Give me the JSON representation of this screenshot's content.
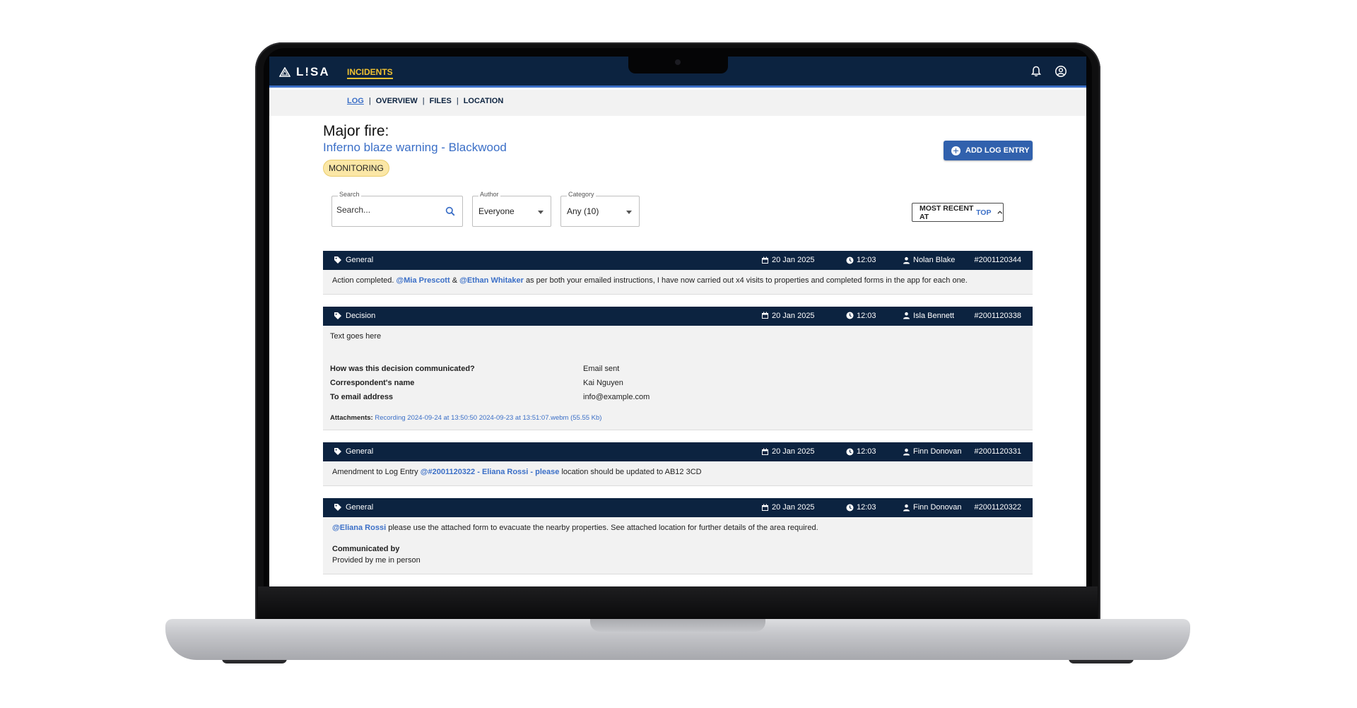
{
  "app": {
    "logo_text": "L!SA",
    "nav_incidents": "INCIDENTS"
  },
  "subnav": {
    "log": "LOG",
    "overview": "OVERVIEW",
    "files": "FILES",
    "location": "LOCATION",
    "separator": "|"
  },
  "incident": {
    "title": "Major fire:",
    "subtitle": "Inferno blaze warning - Blackwood",
    "status": "MONITORING",
    "add_button": "ADD LOG ENTRY"
  },
  "filters": {
    "search_label": "Search",
    "search_placeholder": "Search...",
    "author_label": "Author",
    "author_value": "Everyone",
    "category_label": "Category",
    "category_value": "Any (10)",
    "sort_prefix": "MOST RECENT AT",
    "sort_highlight": "TOP"
  },
  "entries": [
    {
      "category": "General",
      "date": "20 Jan 2025",
      "time": "12:03",
      "author": "Nolan Blake",
      "id": "#2001120344",
      "text_1": "Action completed.",
      "mention_1": "@Mia Prescott",
      "text_2": "&",
      "mention_2": "@Ethan Whitaker",
      "text_3": "as per both your emailed instructions, I have now carried out x4 visits to properties and completed forms in the app for each one."
    },
    {
      "category": "Decision",
      "date": "20 Jan 2025",
      "time": "12:03",
      "author": "Isla Bennett",
      "id": "#2001120338",
      "text": "Text goes here",
      "q1": "How was this decision communicated?",
      "a1": "Email sent",
      "q2": "Correspondent's name",
      "a2": "Kai Nguyen",
      "q3": "To email address",
      "a3": "info@example.com",
      "attach_label": "Attachments:",
      "attach_link": "Recording 2024-09-24 at 13:50:50 2024-09-23 at 13:51:07.webm (55.55 Kb)"
    },
    {
      "category": "General",
      "date": "20 Jan 2025",
      "time": "12:03",
      "author": "Finn Donovan",
      "id": "#2001120331",
      "text_1": "Amendment to Log Entry",
      "mention_1": "@#2001120322 - Eliana Rossi - please",
      "text_2": "location should be updated to AB12 3CD"
    },
    {
      "category": "General",
      "date": "20 Jan 2025",
      "time": "12:03",
      "author": "Finn Donovan",
      "id": "#2001120322",
      "mention_1": "@Eliana Rossi",
      "text_1": "please use the attached form to evacuate the nearby properties. See attached location for further details of the area required.",
      "comm_label": "Communicated by",
      "comm_value": "Provided by me in person"
    }
  ]
}
